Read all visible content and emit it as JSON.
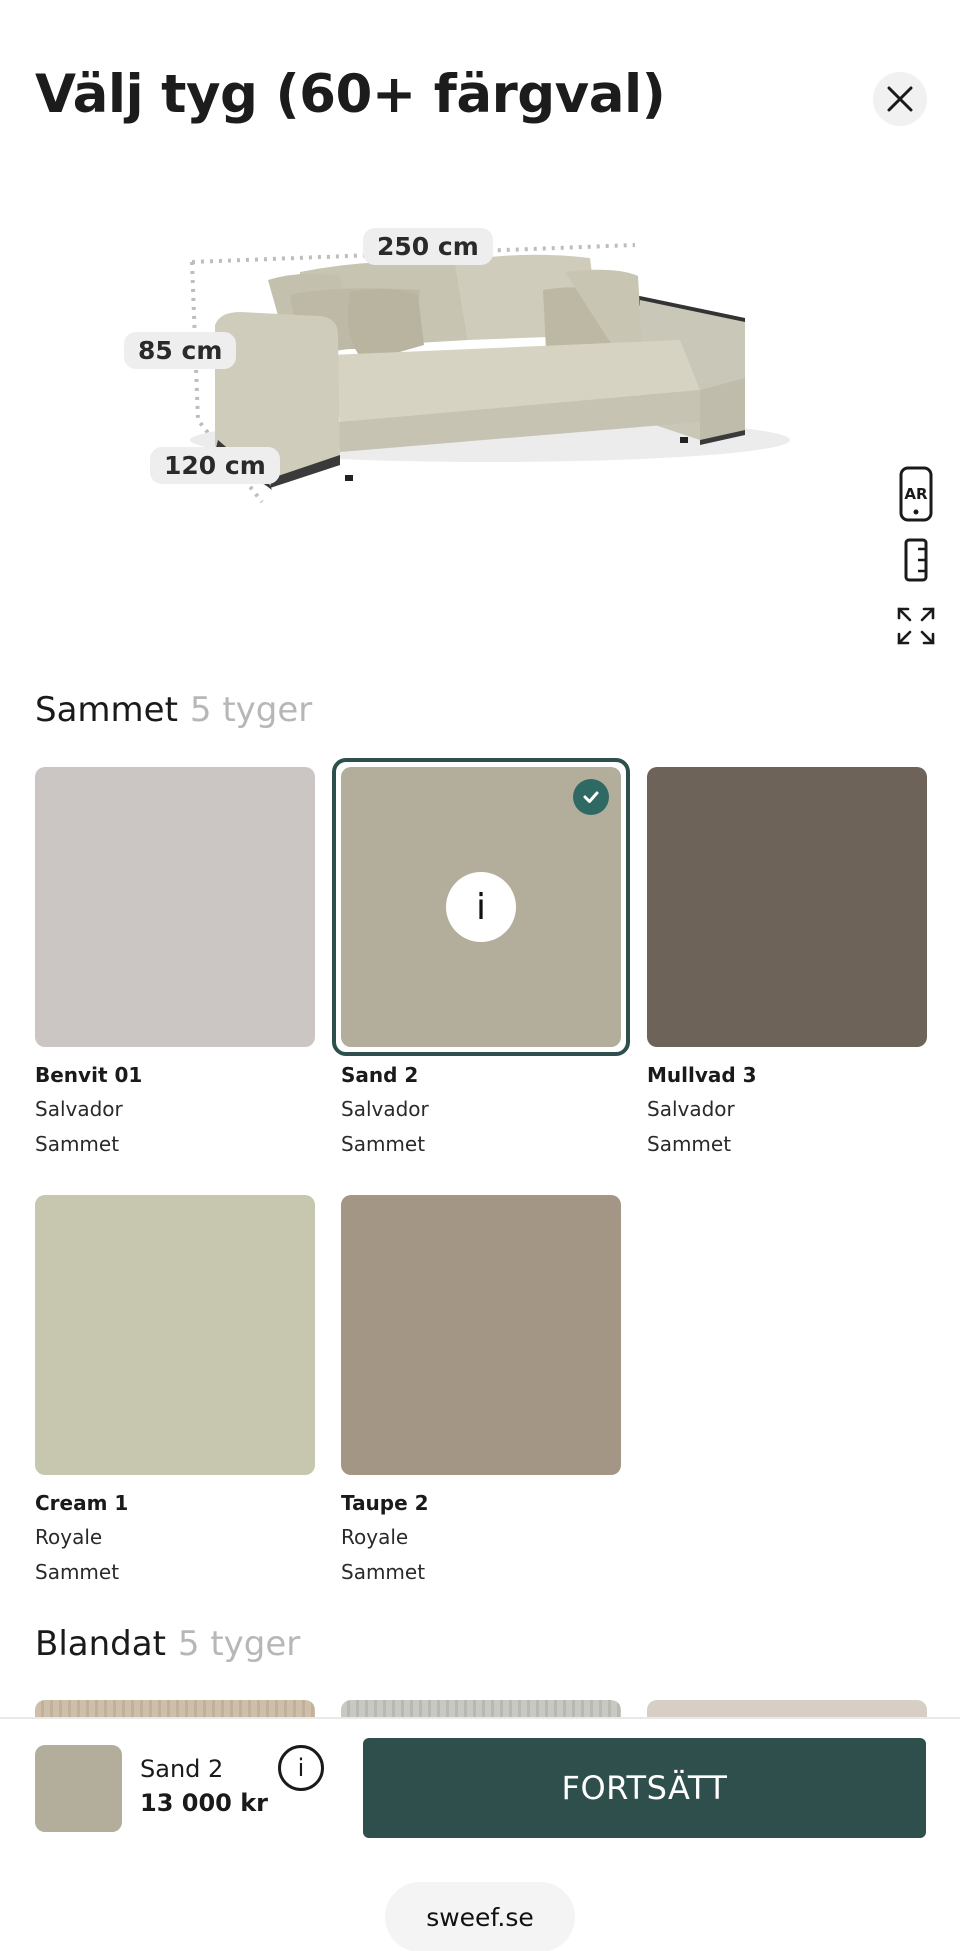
{
  "header": {
    "title": "Välj tyg (60+ färgval)"
  },
  "product": {
    "dimensions": {
      "width": "250 cm",
      "height": "85 cm",
      "depth": "120 cm"
    },
    "tools": [
      "ar-icon",
      "ruler-icon",
      "expand-icon"
    ],
    "tool_labels": {
      "ar": "AR"
    }
  },
  "sections": [
    {
      "title": "Sammet",
      "count": "5 tyger",
      "items": [
        {
          "name": "Benvit 01",
          "line": "Salvador",
          "material": "Sammet",
          "color": "#cbc6c3",
          "selected": false
        },
        {
          "name": "Sand 2",
          "line": "Salvador",
          "material": "Sammet",
          "color": "#b3ad9b",
          "selected": true
        },
        {
          "name": "Mullvad 3",
          "line": "Salvador",
          "material": "Sammet",
          "color": "#6e6358",
          "selected": false
        },
        {
          "name": "Cream 1",
          "line": "Royale",
          "material": "Sammet",
          "color": "#c7c6ae",
          "selected": false
        },
        {
          "name": "Taupe 2",
          "line": "Royale",
          "material": "Sammet",
          "color": "#a49685",
          "selected": false
        }
      ]
    },
    {
      "title": "Blandat",
      "count": "5 tyger",
      "peek_colors": [
        "#cdbfa9",
        "#c9c9c4",
        "#d7cfc6"
      ]
    }
  ],
  "selected_info_icon": "i",
  "footer": {
    "selected_name": "Sand 2",
    "price": "13 000 kr",
    "info_icon": "i",
    "continue_label": "FORTSÄTT",
    "site": "sweef.se"
  },
  "colors": {
    "accent": "#2e4f4c",
    "check": "#2e6a63"
  }
}
